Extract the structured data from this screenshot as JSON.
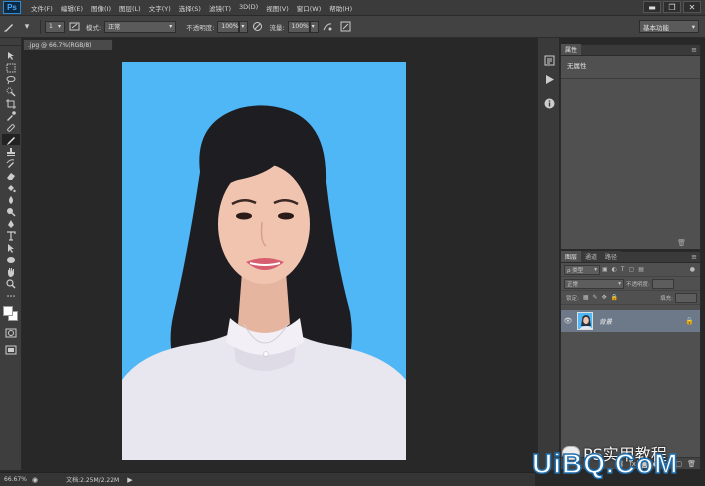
{
  "app": {
    "logo": "Ps"
  },
  "menu": [
    "文件(F)",
    "编辑(E)",
    "图像(I)",
    "图层(L)",
    "文字(Y)",
    "选择(S)",
    "滤镜(T)",
    "3D(D)",
    "视图(V)",
    "窗口(W)",
    "帮助(H)"
  ],
  "window_controls": {
    "minimize": "▬",
    "maximize": "❐",
    "close": "✕"
  },
  "options": {
    "brush_size": "1",
    "mode_label": "模式:",
    "mode_value": "正常",
    "opacity_label": "不透明度:",
    "opacity_value": "100%",
    "flow_label": "流量:",
    "flow_value": "100%",
    "workspace": "基本功能"
  },
  "document": {
    "tab_title": ".jpg @ 66.7%(RGB/8)",
    "canvas_bg": "#4fb7f6"
  },
  "status": {
    "zoom": "66.67%",
    "doc_info": "文档:2.25M/2.22M"
  },
  "properties": {
    "tab": "属性",
    "text": "无属性"
  },
  "layers": {
    "tabs": [
      "图层",
      "通道",
      "路径"
    ],
    "kind_filter": "ρ 类型",
    "blend_mode": "正常",
    "opacity_label": "不透明度:",
    "lock_label": "锁定:",
    "fill_label": "填充:",
    "layer_name": "背景"
  },
  "watermark": {
    "top_text": "PS实用教程",
    "bottom_text": "UiBQ.CoM"
  },
  "colors": {
    "accent": "#2d8ad6",
    "selected_layer": "#6d7888",
    "canvas_blue": "#4fb7f6"
  }
}
